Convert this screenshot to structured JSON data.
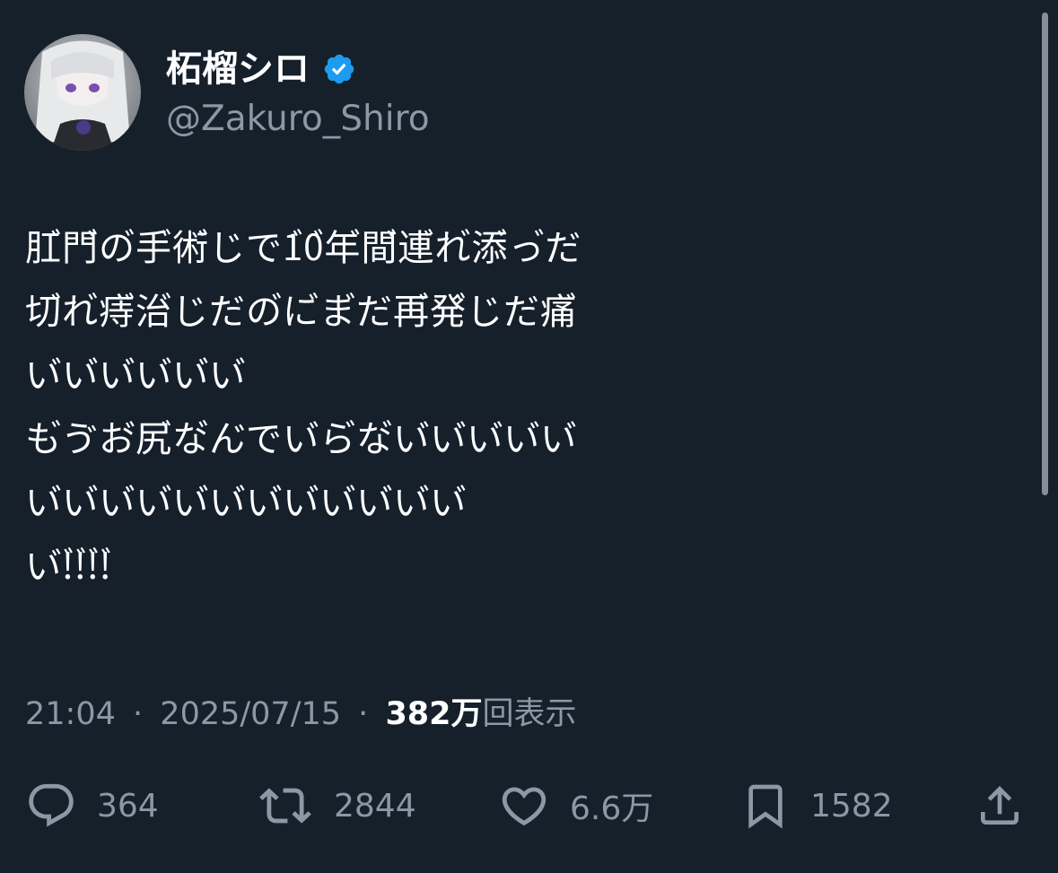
{
  "user": {
    "display_name": "柘榴シロ",
    "handle": "@Zakuro_Shiro",
    "verified_icon": "verified-badge-icon",
    "accent_color": "#1d9bf0"
  },
  "tweet": {
    "lines": [
      "肛゙門゙の゙手゙術゙じで1゙0゙年゙間゙連゙れ゙添゙っ゙だ",
      "切゙れ゙痔゙治゙じだの゙に゙ま゙だ再゙発゙じだ痛゙",
      "い゙い゙い゙い゙い゙い゙",
      "も゙ゔお゙尻゙な゙ん゙でい゙ら゙な゙い゙い゙い゙い゙い゙",
      "い゙い゙い゙い゙い゙い゙い゙い゙い゙い゙い゙い゙",
      "い゙!゙!゙!゙!゙"
    ]
  },
  "meta": {
    "time": "21:04",
    "separator": "·",
    "date": "2025/07/15",
    "views_count": "382万",
    "views_label": "回表示"
  },
  "actions": {
    "reply": {
      "icon": "reply-icon",
      "count": "364"
    },
    "retweet": {
      "icon": "retweet-icon",
      "count": "2844"
    },
    "like": {
      "icon": "heart-icon",
      "count": "6.6万"
    },
    "bookmark": {
      "icon": "bookmark-icon",
      "count": "1582"
    },
    "share": {
      "icon": "share-icon"
    }
  },
  "colors": {
    "background": "#15202b",
    "text_primary": "#ffffff",
    "text_secondary": "#8b98a5"
  }
}
